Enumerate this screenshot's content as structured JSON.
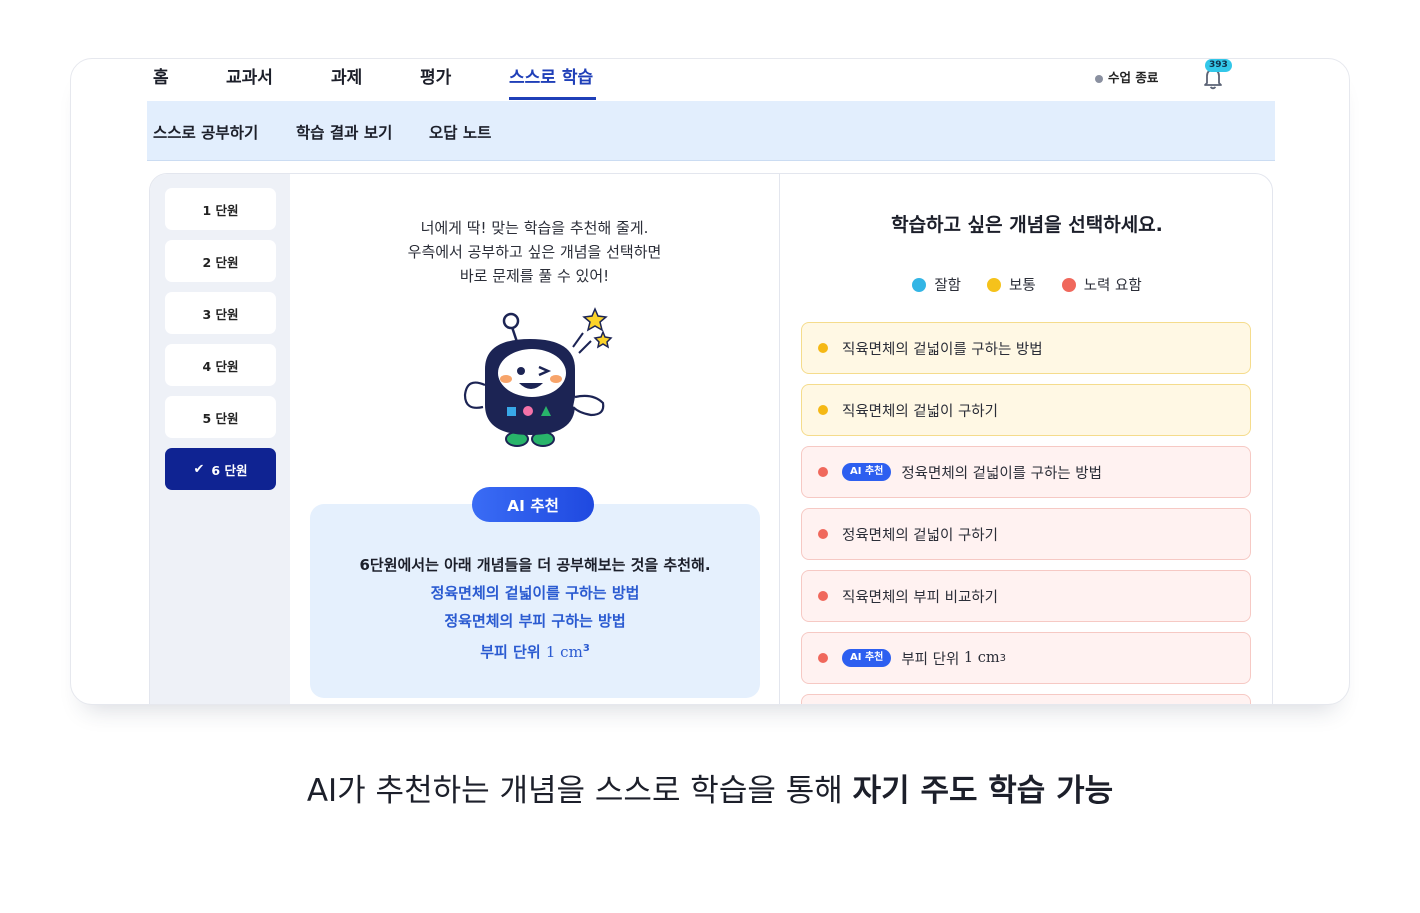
{
  "topnav": {
    "tabs": [
      "홈",
      "교과서",
      "과제",
      "평가",
      "스스로 학습"
    ],
    "active_tab": "스스로 학습",
    "class_end_label": "수업 종료",
    "notification_count": "393"
  },
  "subnav": {
    "items": [
      "스스로 공부하기",
      "학습 결과 보기",
      "오답 노트"
    ]
  },
  "units": [
    "1 단원",
    "2 단원",
    "3 단원",
    "4 단원",
    "5 단원",
    "6 단원"
  ],
  "active_unit": "6 단원",
  "middle": {
    "intro_lines": [
      "너에게 딱! 맞는 학습을 추천해 줄게.",
      "우측에서 공부하고 싶은 개념을 선택하면",
      "바로 문제를 풀 수 있어!"
    ],
    "ai_badge": "AI 추천",
    "reco_title": "6단원에서는 아래 개념들을 더 공부해보는 것을 추천해.",
    "reco_items": [
      "정육면체의 겉넓이를 구하는 방법",
      "정육면체의 부피 구하는 방법"
    ],
    "reco_unit_text": "부피 단위",
    "reco_unit_math": "1 cm",
    "reco_unit_exp": "3"
  },
  "right": {
    "title": "학습하고 싶은 개념을 선택하세요.",
    "legend": [
      {
        "label": "잘함",
        "color": "#33b5e5"
      },
      {
        "label": "보통",
        "color": "#f5c21b"
      },
      {
        "label": "노력 요함",
        "color": "#f0685c"
      }
    ],
    "ai_tag": "AI 추천",
    "concepts": [
      {
        "label": "직육면체의 겉넓이를 구하는 방법",
        "level": "yellow",
        "ai": false
      },
      {
        "label": "직육면체의 겉넓이 구하기",
        "level": "yellow",
        "ai": false
      },
      {
        "label": "정육면체의 겉넓이를 구하는 방법",
        "level": "red",
        "ai": true
      },
      {
        "label": "정육면체의 겉넓이 구하기",
        "level": "red",
        "ai": false
      },
      {
        "label": "직육면체의 부피 비교하기",
        "level": "red",
        "ai": false
      },
      {
        "label": "부피 단위",
        "math": "1 cm",
        "exp": "3",
        "level": "red",
        "ai": true
      }
    ]
  },
  "caption": {
    "normal": "AI가 추천하는 개념을 스스로 학습을 통해 ",
    "bold": "자기 주도 학습 가능"
  }
}
